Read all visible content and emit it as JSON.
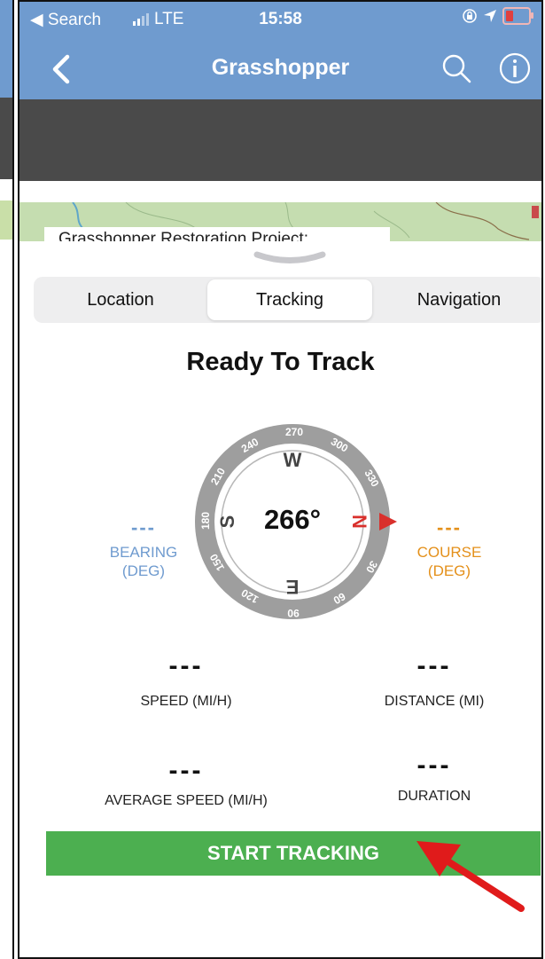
{
  "status_bar": {
    "back_label": "◀ Search",
    "network": "LTE",
    "time": "15:58"
  },
  "nav": {
    "title": "Grasshopper",
    "back_icon": "chevron-left-icon",
    "search_icon": "search-icon",
    "info_icon": "info-icon"
  },
  "map": {
    "label": "Grasshopper Restoration Project:"
  },
  "tabs": [
    {
      "label": "Location",
      "active": false
    },
    {
      "label": "Tracking",
      "active": true
    },
    {
      "label": "Navigation",
      "active": false
    }
  ],
  "tracking": {
    "title": "Ready To Track",
    "heading": "266°",
    "bearing": {
      "value": "---",
      "label_line1": "BEARING",
      "label_line2": "(DEG)"
    },
    "course": {
      "value": "---",
      "label_line1": "COURSE",
      "label_line2": "(DEG)"
    },
    "compass": {
      "cardinals": {
        "W": "W",
        "S": "S",
        "N": "N",
        "E": "E"
      },
      "dial_labels": [
        "270",
        "300",
        "330",
        "30",
        "60",
        "90",
        "120",
        "150",
        "180",
        "210",
        "240"
      ]
    },
    "stats": [
      {
        "value": "---",
        "label": "SPEED (MI/H)"
      },
      {
        "value": "---",
        "label": "DISTANCE (MI)"
      },
      {
        "value": "---",
        "label": "AVERAGE SPEED (MI/H)"
      },
      {
        "value": "---",
        "label": "DURATION"
      }
    ],
    "start_button": "START TRACKING"
  },
  "colors": {
    "nav_blue": "#6f9bcf",
    "bearing": "#6f9bcf",
    "course": "#e4901a",
    "start_green": "#4caf50",
    "north_red": "#d9302c",
    "annotation_arrow": "#e01b1b"
  }
}
